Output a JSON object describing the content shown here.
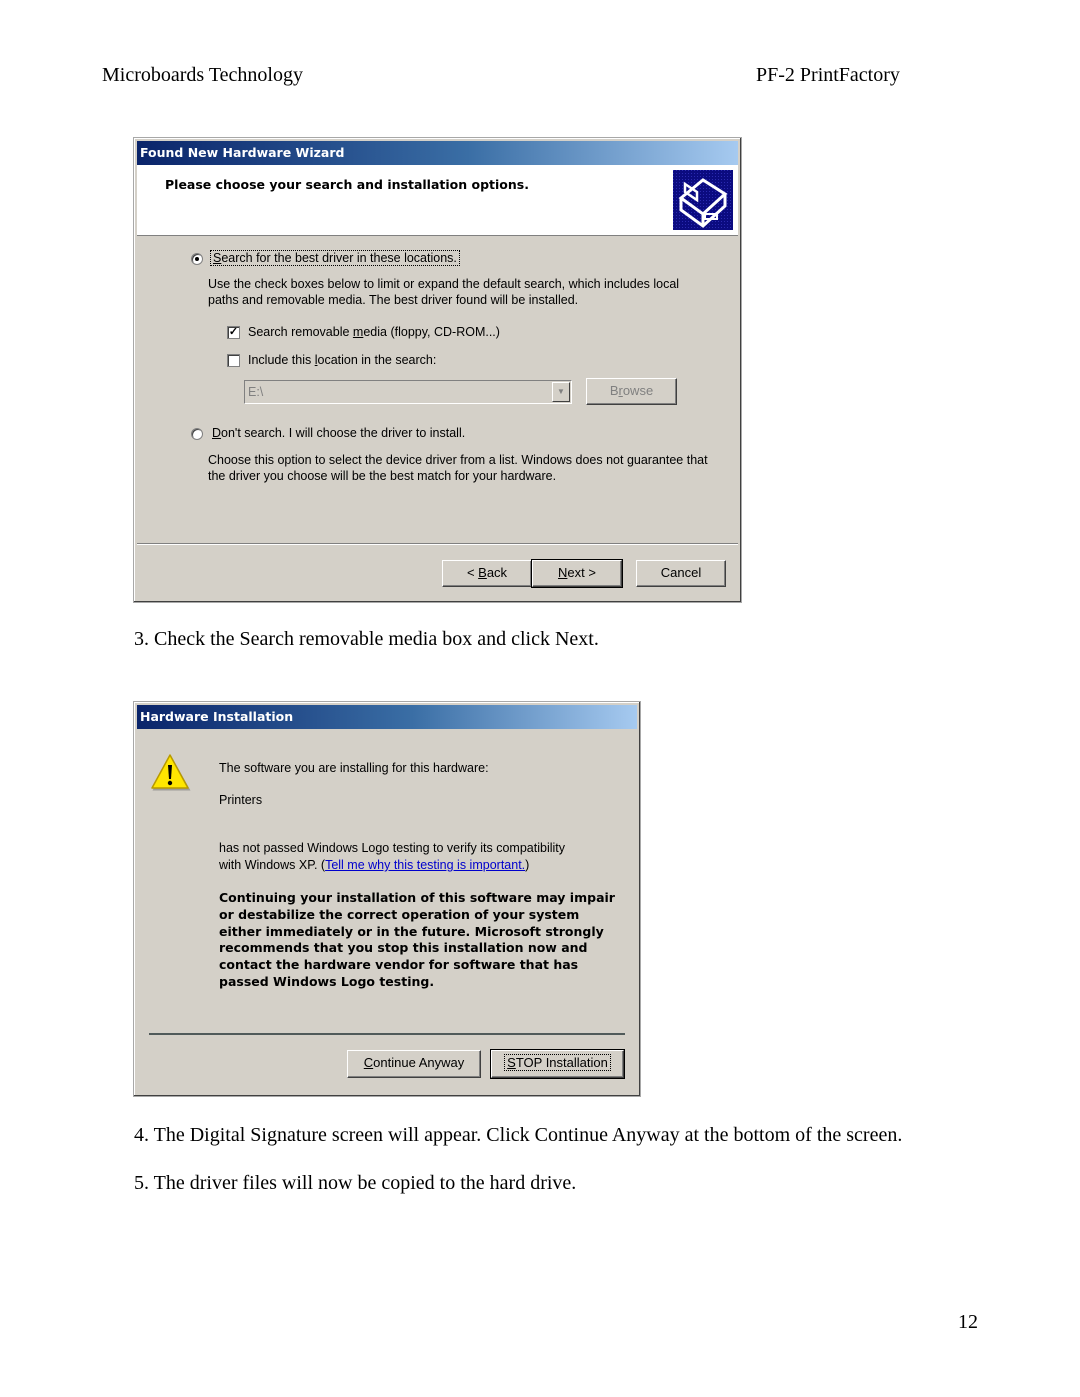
{
  "header": {
    "left": "Microboards Technology",
    "right": "PF-2 PrintFactory"
  },
  "wizard": {
    "title": "Found New Hardware Wizard",
    "heading": "Please choose your search and installation options.",
    "icon": "hardware-wizard-icon",
    "option_search": {
      "label_prefix": "",
      "mnemonic": "S",
      "label_rest": "earch for the best driver in these locations.",
      "selected": true
    },
    "search_desc_1": "Use the check boxes below to limit or expand the default search, which includes local",
    "search_desc_2": "paths and removable media. The best driver found will be installed.",
    "check_removable": {
      "label_a": "Search removable ",
      "mnemonic": "m",
      "label_b": "edia (floppy, CD-ROM...)",
      "checked": true
    },
    "check_location": {
      "label_a": "Include this ",
      "mnemonic": "l",
      "label_b": "ocation in the search:",
      "checked": false
    },
    "location_value": "E:\\",
    "browse": {
      "a": "B",
      "mnemonic": "r",
      "b": "owse"
    },
    "option_dont": {
      "mnemonic": "D",
      "label_rest": "on't search. I will choose the driver to install.",
      "selected": false
    },
    "dont_desc_1": "Choose this option to select the device driver from a list.  Windows does not guarantee that",
    "dont_desc_2": "the driver you choose will be the best match for your hardware.",
    "back": {
      "a": "< ",
      "mnemonic": "B",
      "b": "ack"
    },
    "next": {
      "mnemonic": "N",
      "b": "ext >"
    },
    "cancel": "Cancel"
  },
  "step3": "3.   Check the Search removable media box and click Next.",
  "hwinstall": {
    "title": "Hardware Installation",
    "icon": "warning-icon",
    "line1": "The software you are installing for this hardware:",
    "device": "Printers",
    "line2": "has not passed Windows Logo testing to verify its compatibility",
    "line3_prefix": "with Windows XP. (",
    "link": "Tell me why this testing is important.",
    "line3_suffix": ")",
    "warning": [
      "Continuing your installation of this software may impair",
      "or destabilize the correct operation of your system",
      "either immediately or in the future. Microsoft strongly",
      "recommends that you stop this installation now and",
      "contact the hardware vendor for software that has",
      "passed Windows Logo testing."
    ],
    "continue": {
      "mnemonic": "C",
      "b": "ontinue Anyway"
    },
    "stop": {
      "mnemonic": "S",
      "b": "TOP Installation"
    }
  },
  "step4": "4.   The Digital Signature screen will appear.  Click Continue Anyway at the bottom of the screen.",
  "step5": "5.   The driver files will now be copied to the hard drive.",
  "page_number": "12"
}
